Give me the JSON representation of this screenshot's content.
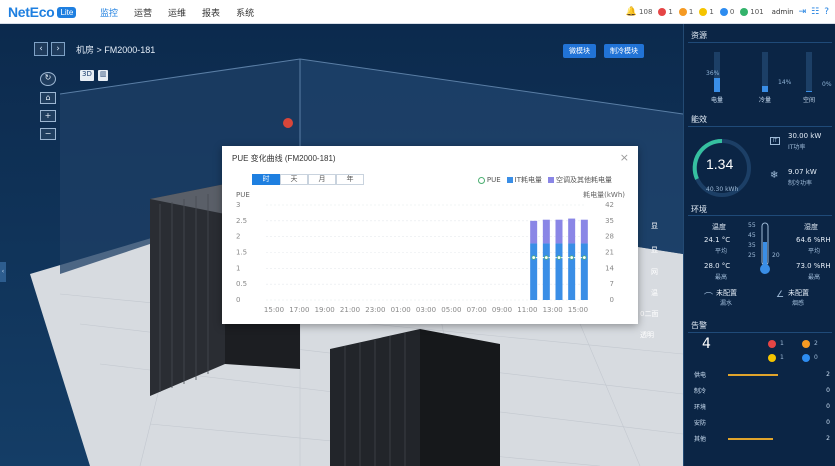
{
  "topbar": {
    "logo": "NetEco",
    "logo_badge": "Lite",
    "nav": [
      "监控",
      "运营",
      "运维",
      "报表",
      "系统"
    ],
    "status": [
      {
        "label": "108",
        "color": "#f5b400"
      },
      {
        "label": "1",
        "color": "#e54545"
      },
      {
        "label": "1",
        "color": "#f59a23"
      },
      {
        "label": "1",
        "color": "#f5c400"
      },
      {
        "label": "0",
        "color": "#2d8cf0"
      },
      {
        "label": "101",
        "color": "#33b36b"
      }
    ],
    "user": "admin"
  },
  "scene": {
    "breadcrumb": "机房 > FM2000-181",
    "toggle_3d": "3D",
    "toggle_chart": "▥",
    "btn_a": "微模块",
    "btn_b": "制冷模块",
    "right_labels": [
      "显",
      "显",
      "网",
      "温",
      "0二面",
      "透明"
    ]
  },
  "modal": {
    "title": "PUE 变化曲线 (FM2000-181)",
    "close": "×",
    "tabs": [
      "时",
      "天",
      "月",
      "年"
    ],
    "active_tab": 0,
    "legend": [
      {
        "label": "PUE",
        "color": "#4caf72"
      },
      {
        "label": "IT耗电量",
        "color": "#3a8ee6"
      },
      {
        "label": "空调及其他耗电量",
        "color": "#8a86e6"
      }
    ]
  },
  "chart_data": {
    "type": "bar",
    "x_ticks": [
      "15:00",
      "17:00",
      "19:00",
      "21:00",
      "23:00",
      "01:00",
      "03:00",
      "05:00",
      "07:00",
      "09:00",
      "11:00",
      "13:00",
      "15:00"
    ],
    "ylabel_left": "PUE",
    "ylabel_right": "耗电量(kWh)",
    "y_left_ticks": [
      "3",
      "2.5",
      "2",
      "1.5",
      "1",
      "0.5",
      "0"
    ],
    "y_right_ticks": [
      "42",
      "35",
      "28",
      "21",
      "14",
      "7",
      "0"
    ],
    "ylim_left": [
      0,
      3
    ],
    "ylim_right": [
      0,
      42
    ],
    "grid": true,
    "bars": [
      {
        "x_index": 10.25,
        "it": 25,
        "other": 10,
        "pue": 1.34
      },
      {
        "x_index": 10.75,
        "it": 25,
        "other": 10.5,
        "pue": 1.34
      },
      {
        "x_index": 11.25,
        "it": 25,
        "other": 10.5,
        "pue": 1.34
      },
      {
        "x_index": 11.75,
        "it": 25,
        "other": 11,
        "pue": 1.34
      },
      {
        "x_index": 12.25,
        "it": 25,
        "other": 10.5,
        "pue": 1.34
      }
    ]
  },
  "rpanel": {
    "res_title": "资源",
    "res": [
      {
        "label": "电量",
        "pct": "36%",
        "level": 0.36
      },
      {
        "label": "冷量",
        "pct": "14%",
        "level": 0.14
      },
      {
        "label": "空间",
        "pct": "0%",
        "level": 0.02
      }
    ],
    "eff_title": "能效",
    "pue": "1.34",
    "pue_sub": "40.30 kWh",
    "it_power": "30.00 kW",
    "it_power_label": "IT功率",
    "cool_power": "9.07 kW",
    "cool_power_label": "制冷功率",
    "env_title": "环境",
    "temp_label": "温度",
    "humid_label": "湿度",
    "temp_avg": "24.1 °C",
    "humid_avg": "64.6 %RH",
    "avg_label": "平均",
    "temp_max": "28.0 °C",
    "humid_max": "73.0 %RH",
    "max_label": "最高",
    "scale": [
      "55",
      "45",
      "35",
      "25",
      "20"
    ],
    "leak_a": "未配置",
    "leak_a_sub": "漏水",
    "leak_b": "未配置",
    "leak_b_sub": "烟感",
    "alarm_title": "告警",
    "alarm_total": "4",
    "alarm_counts": [
      {
        "n": "1",
        "color": "#e54545"
      },
      {
        "n": "2",
        "color": "#f59a23"
      },
      {
        "n": "1",
        "color": "#f5c400"
      },
      {
        "n": "0",
        "color": "#2d8cf0"
      }
    ],
    "alarm_rows": [
      {
        "label": "供电",
        "count": "2",
        "level": 0.55,
        "color": "#e0a42c"
      },
      {
        "label": "制冷",
        "count": "0",
        "level": 0,
        "color": "#e0a42c"
      },
      {
        "label": "环境",
        "count": "0",
        "level": 0,
        "color": "#e0a42c"
      },
      {
        "label": "安防",
        "count": "0",
        "level": 0,
        "color": "#e0a42c"
      },
      {
        "label": "其他",
        "count": "2",
        "level": 0.5,
        "color": "#e0a42c"
      }
    ]
  }
}
